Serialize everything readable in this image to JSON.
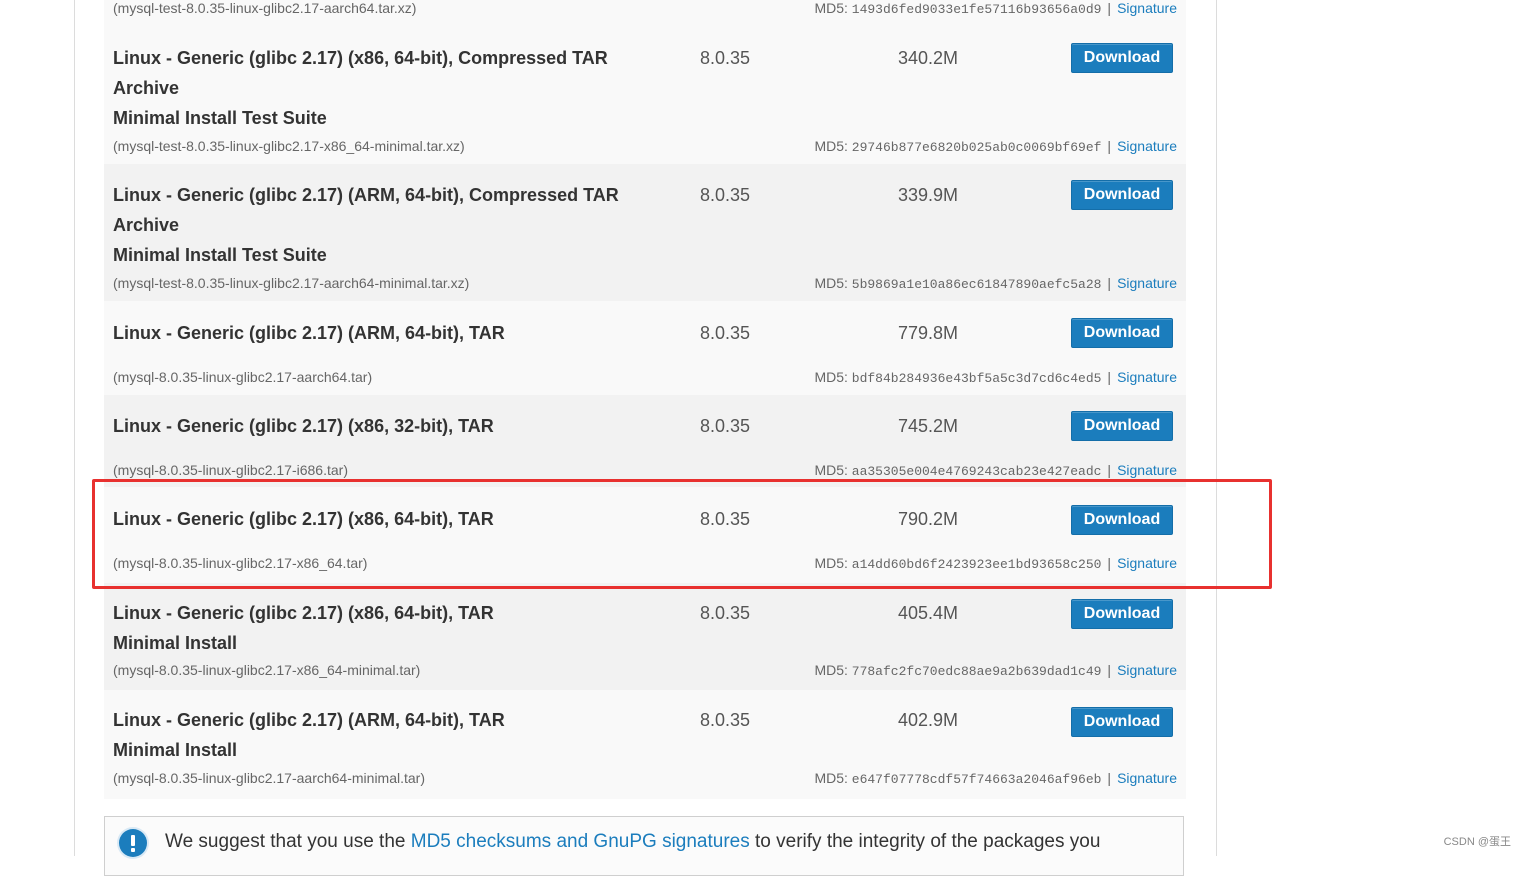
{
  "top_partial": {
    "file": "(mysql-test-8.0.35-linux-glibc2.17-aarch64.tar.xz)",
    "md5_label": "MD5:",
    "md5": "1493d6fed9033e1fe57116b93656a0d9",
    "separator": "|",
    "signature": "Signature"
  },
  "rows": [
    {
      "title_line1": "Linux - Generic (glibc 2.17) (x86, 64-bit), Compressed TAR",
      "title_line2": "Archive",
      "title_line3": "Minimal Install Test Suite",
      "version": "8.0.35",
      "size": "340.2M",
      "button": "Download",
      "file": "(mysql-test-8.0.35-linux-glibc2.17-x86_64-minimal.tar.xz)",
      "md5_label": "MD5:",
      "md5": "29746b877e6820b025ab0c0069bf69ef",
      "separator": "|",
      "signature": "Signature"
    },
    {
      "title_line1": "Linux - Generic (glibc 2.17) (ARM, 64-bit), Compressed TAR",
      "title_line2": "Archive",
      "title_line3": "Minimal Install Test Suite",
      "version": "8.0.35",
      "size": "339.9M",
      "button": "Download",
      "file": "(mysql-test-8.0.35-linux-glibc2.17-aarch64-minimal.tar.xz)",
      "md5_label": "MD5:",
      "md5": "5b9869a1e10a86ec61847890aefc5a28",
      "separator": "|",
      "signature": "Signature"
    },
    {
      "title_line1": "Linux - Generic (glibc 2.17) (ARM, 64-bit), TAR",
      "version": "8.0.35",
      "size": "779.8M",
      "button": "Download",
      "file": "(mysql-8.0.35-linux-glibc2.17-aarch64.tar)",
      "md5_label": "MD5:",
      "md5": "bdf84b284936e43bf5a5c3d7cd6c4ed5",
      "separator": "|",
      "signature": "Signature"
    },
    {
      "title_line1": "Linux - Generic (glibc 2.17) (x86, 32-bit), TAR",
      "version": "8.0.35",
      "size": "745.2M",
      "button": "Download",
      "file": "(mysql-8.0.35-linux-glibc2.17-i686.tar)",
      "md5_label": "MD5:",
      "md5": "aa35305e004e4769243cab23e427eadc",
      "separator": "|",
      "signature": "Signature"
    },
    {
      "title_line1": "Linux - Generic (glibc 2.17) (x86, 64-bit), TAR",
      "version": "8.0.35",
      "size": "790.2M",
      "button": "Download",
      "file": "(mysql-8.0.35-linux-glibc2.17-x86_64.tar)",
      "md5_label": "MD5:",
      "md5": "a14dd60bd6f2423923ee1bd93658c250",
      "separator": "|",
      "signature": "Signature"
    },
    {
      "title_line1": "Linux - Generic (glibc 2.17) (x86, 64-bit), TAR",
      "title_line2": "Minimal Install",
      "version": "8.0.35",
      "size": "405.4M",
      "button": "Download",
      "file": "(mysql-8.0.35-linux-glibc2.17-x86_64-minimal.tar)",
      "md5_label": "MD5:",
      "md5": "778afc2fc70edc88ae9a2b639dad1c49",
      "separator": "|",
      "signature": "Signature"
    },
    {
      "title_line1": "Linux - Generic (glibc 2.17) (ARM, 64-bit), TAR",
      "title_line2": "Minimal Install",
      "version": "8.0.35",
      "size": "402.9M",
      "button": "Download",
      "file": "(mysql-8.0.35-linux-glibc2.17-aarch64-minimal.tar)",
      "md5_label": "MD5:",
      "md5": "e647f07778cdf57f74663a2046af96eb",
      "separator": "|",
      "signature": "Signature"
    }
  ],
  "notice": {
    "text_before": "We suggest that you use the ",
    "link": "MD5 checksums and GnuPG signatures",
    "text_after": " to verify the integrity of the packages you"
  },
  "watermark": "CSDN @蛋王",
  "colors": {
    "link": "#1b7dbd",
    "button_bg": "#1b7dbd",
    "highlight_border": "#e8312f"
  }
}
